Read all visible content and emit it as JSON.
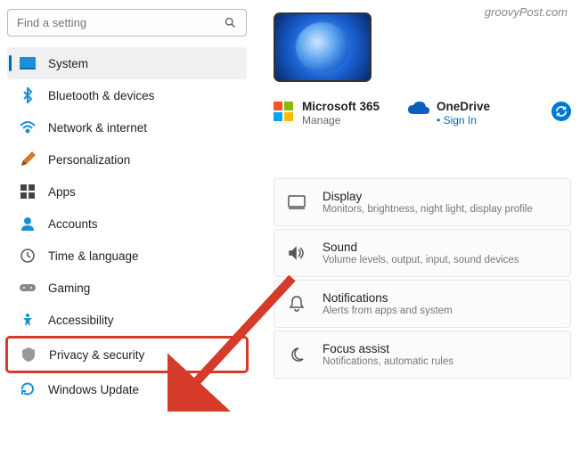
{
  "watermark": "groovyPost.com",
  "search": {
    "placeholder": "Find a setting"
  },
  "nav": {
    "items": [
      {
        "label": "System"
      },
      {
        "label": "Bluetooth & devices"
      },
      {
        "label": "Network & internet"
      },
      {
        "label": "Personalization"
      },
      {
        "label": "Apps"
      },
      {
        "label": "Accounts"
      },
      {
        "label": "Time & language"
      },
      {
        "label": "Gaming"
      },
      {
        "label": "Accessibility"
      },
      {
        "label": "Privacy & security"
      },
      {
        "label": "Windows Update"
      }
    ]
  },
  "accounts": {
    "ms365": {
      "title": "Microsoft 365",
      "sub": "Manage"
    },
    "onedrive": {
      "title": "OneDrive",
      "link": "Sign In"
    }
  },
  "cards": [
    {
      "title": "Display",
      "sub": "Monitors, brightness, night light, display profile"
    },
    {
      "title": "Sound",
      "sub": "Volume levels, output, input, sound devices"
    },
    {
      "title": "Notifications",
      "sub": "Alerts from apps and system"
    },
    {
      "title": "Focus assist",
      "sub": "Notifications, automatic rules"
    }
  ]
}
